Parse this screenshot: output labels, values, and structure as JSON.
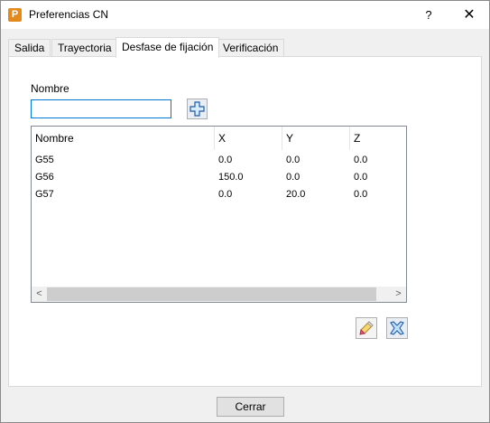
{
  "window": {
    "title": "Preferencias CN",
    "icon_letter": "P",
    "help_label": "?",
    "close_label": "✕",
    "accent_color": "#0078d7",
    "app_icon_color": "#e48a1c"
  },
  "tabs": [
    {
      "label": "Salida",
      "active": false
    },
    {
      "label": "Trayectoria",
      "active": false
    },
    {
      "label": "Desfase de fijación",
      "active": true
    },
    {
      "label": "Verificación",
      "active": false
    }
  ],
  "form": {
    "name_label": "Nombre",
    "name_value": "",
    "add_icon": "plus-icon"
  },
  "table": {
    "columns": [
      "Nombre",
      "X",
      "Y",
      "Z"
    ],
    "rows": [
      [
        "G55",
        "0.0",
        "0.0",
        "0.0"
      ],
      [
        "G56",
        "150.0",
        "0.0",
        "0.0"
      ],
      [
        "G57",
        "0.0",
        "20.0",
        "0.0"
      ]
    ],
    "scroll_left": "<",
    "scroll_right": ">"
  },
  "actions": {
    "edit_icon": "pencil-icon",
    "delete_icon": "delete-x-icon"
  },
  "footer": {
    "close_button_label": "Cerrar"
  }
}
